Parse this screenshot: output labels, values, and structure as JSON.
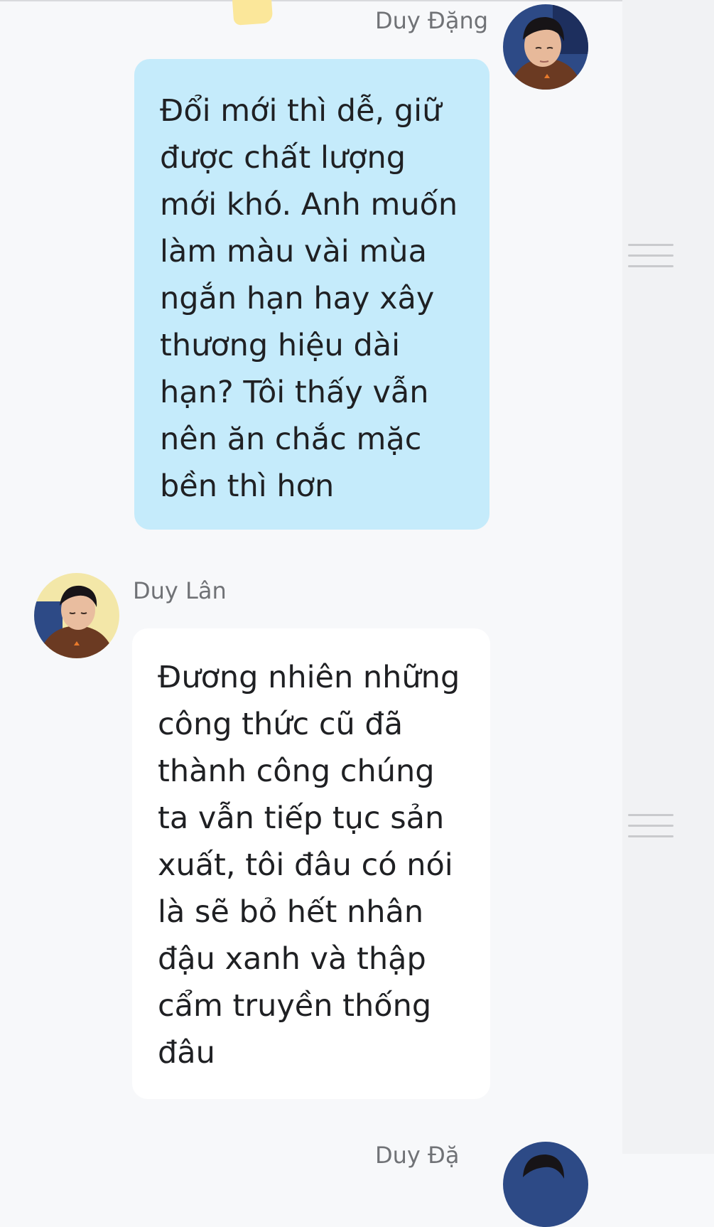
{
  "messages": [
    {
      "sender": "Duy Đặng",
      "direction": "outgoing",
      "lines": [
        "Đổi mới thì dễ, giữ",
        "được chất lượng",
        "mới khó. Anh muốn",
        "làm màu vài mùa",
        "ngắn hạn hay xây",
        "thương hiệu dài",
        "hạn? Tôi thấy vẫn",
        "nên ăn chắc mặc",
        "bền thì hơn"
      ]
    },
    {
      "sender": "Duy Lân",
      "direction": "incoming",
      "lines": [
        "Đương nhiên những",
        "công thức cũ đã",
        "thành công chúng",
        "ta vẫn tiếp tục sản",
        "xuất, tôi đâu có nói",
        "là sẽ bỏ hết nhân",
        "đậu xanh và thập",
        "cẩm truyền thống",
        "đâu"
      ]
    },
    {
      "sender": "Duy Đặ",
      "direction": "outgoing",
      "lines": []
    }
  ],
  "icons": {
    "drag_handle": "hamburger-drag-handle-icon",
    "avatar": "avatar-photo"
  },
  "colors": {
    "outgoing_bubble": "#c5ebfb",
    "incoming_bubble": "#ffffff",
    "background": "#f7f8fa",
    "sender_name": "#707276",
    "message_text": "#1f2023"
  }
}
